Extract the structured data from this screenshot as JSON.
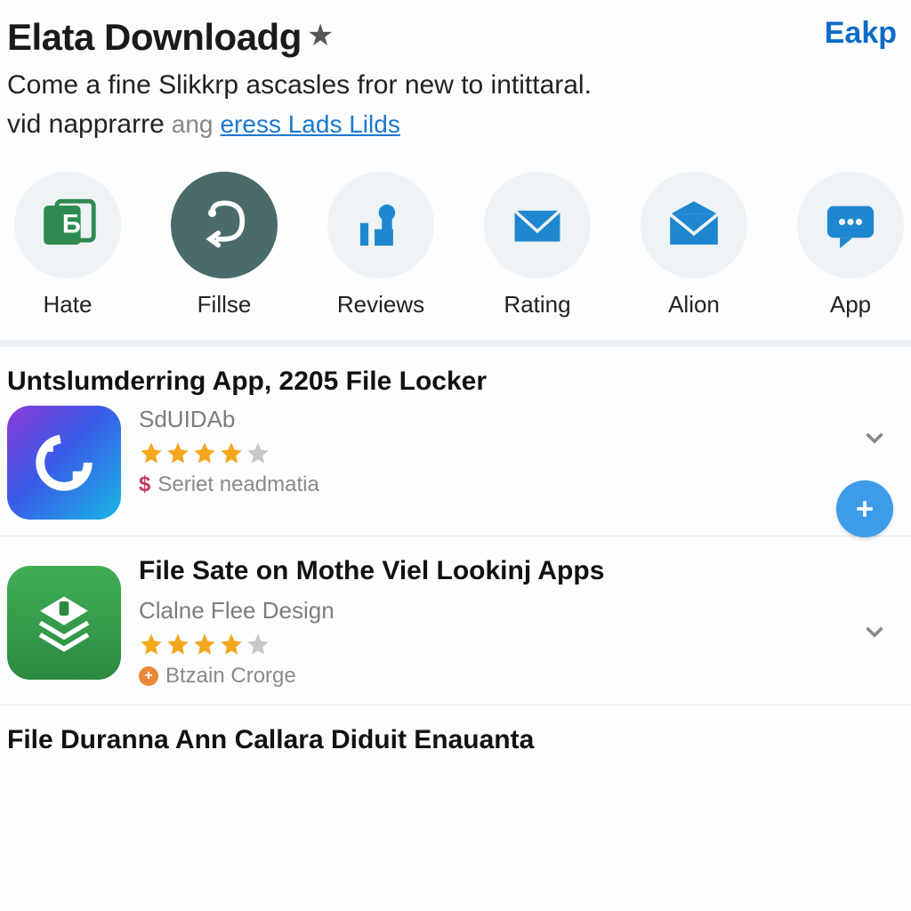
{
  "header": {
    "title": "Elata Downloadg",
    "action": "Eakp"
  },
  "subtitle": {
    "line1": "Come a fine Slikkrp ascasles fror new to intittaral.",
    "line2_plain": "vid napprarre",
    "line2_muted": "ang",
    "line2_link": "eress Lads Lilds"
  },
  "categories": [
    {
      "label": "Hate",
      "icon": "b-card"
    },
    {
      "label": "Fillse",
      "icon": "hook"
    },
    {
      "label": "Reviews",
      "icon": "chart-person"
    },
    {
      "label": "Rating",
      "icon": "mail"
    },
    {
      "label": "Alion",
      "icon": "mail-flap"
    },
    {
      "label": "App",
      "icon": "chat"
    }
  ],
  "apps": [
    {
      "title": "Untslumderring App, 2205 File Locker",
      "developer": "SdUIDAb",
      "rating": 4,
      "tag_kind": "dollar",
      "tag_text": "Seriet neadmatia",
      "has_plus": true
    },
    {
      "title": "File Sate on Mothe Viel Lookinj Apps",
      "developer": "Clalne Flee Design",
      "rating": 4,
      "tag_kind": "badge",
      "tag_text": "Btzain Crorge",
      "has_plus": false
    }
  ],
  "partial_next": "File Duranna Ann Callara Diduit Enauanta",
  "colors": {
    "accent": "#1b78d0",
    "icon_blue": "#1f87cf",
    "icon_green": "#2f8a52"
  }
}
